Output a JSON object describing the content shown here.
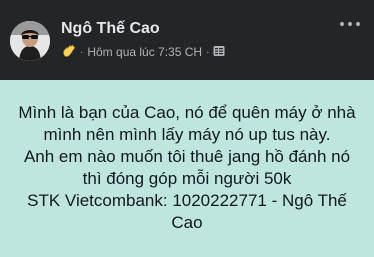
{
  "post": {
    "author_name": "Ngô Thế Cao",
    "timestamp": "Hôm qua lúc 7:35 CH",
    "separator": "·",
    "audience_icon": "friends-list-icon",
    "wave_icon": "wave-icon",
    "more_icon": "more-options-icon",
    "body_text": "Mình là bạn của Cao, nó để quên máy ở nhà mình nên mình lấy máy nó up tus này.\nAnh em nào muốn tôi thuê jang hồ đánh nó thì đóng góp mỗi người 50k\nSTK Vietcombank: 1020222771 - Ngô Thế Cao"
  },
  "colors": {
    "header_bg": "#242526",
    "post_bg": "#bfe6dc",
    "name_color": "#e4e6eb",
    "meta_color": "#b0b3b8",
    "body_text_color": "#101820"
  }
}
